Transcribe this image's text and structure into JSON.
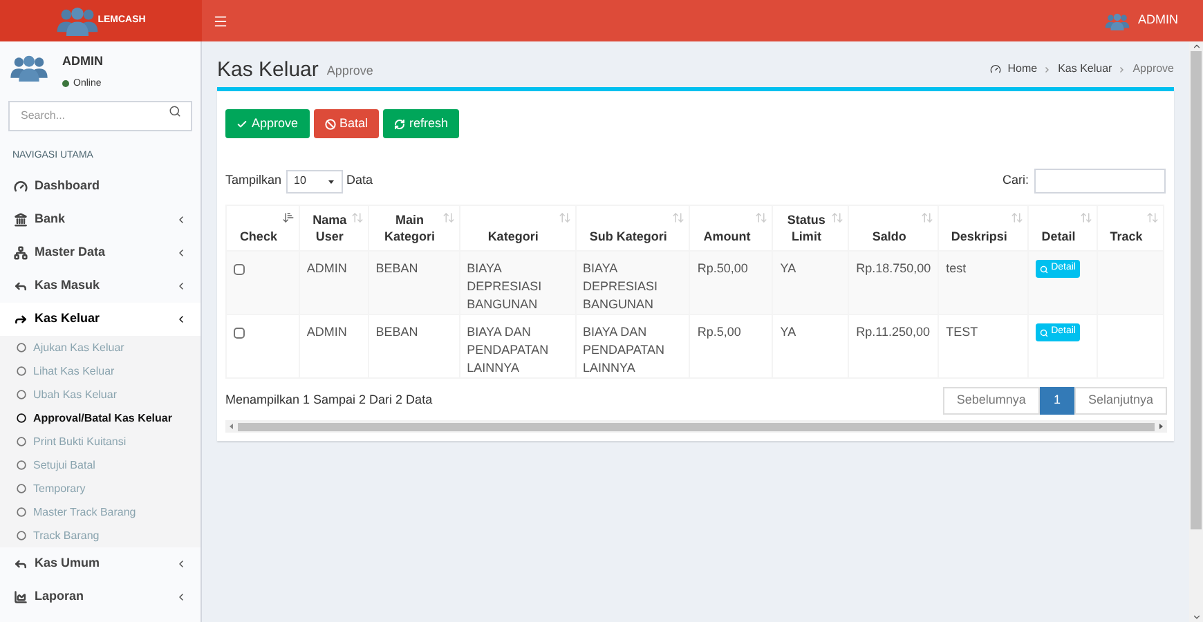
{
  "header": {
    "brand": "LEMCASH",
    "user": "ADMIN"
  },
  "sidebar": {
    "user": {
      "name": "ADMIN",
      "status": "Online"
    },
    "search": {
      "placeholder": "Search..."
    },
    "section": "NAVIGASI UTAMA",
    "items": [
      {
        "label": "Dashboard",
        "has_children": false,
        "expanded": false
      },
      {
        "label": "Bank",
        "has_children": true,
        "expanded": false
      },
      {
        "label": "Master Data",
        "has_children": true,
        "expanded": false
      },
      {
        "label": "Kas Masuk",
        "has_children": true,
        "expanded": false
      },
      {
        "label": "Kas Keluar",
        "has_children": true,
        "expanded": true,
        "children": [
          {
            "label": "Ajukan Kas Keluar",
            "selected": false
          },
          {
            "label": "Lihat Kas Keluar",
            "selected": false
          },
          {
            "label": "Ubah Kas Keluar",
            "selected": false
          },
          {
            "label": "Approval/Batal Kas Keluar",
            "selected": true
          },
          {
            "label": "Print Bukti Kuitansi",
            "selected": false
          },
          {
            "label": "Setujui Batal",
            "selected": false
          },
          {
            "label": "Temporary",
            "selected": false
          },
          {
            "label": "Master Track Barang",
            "selected": false
          },
          {
            "label": "Track Barang",
            "selected": false
          }
        ]
      },
      {
        "label": "Kas Umum",
        "has_children": true,
        "expanded": false
      },
      {
        "label": "Laporan",
        "has_children": true,
        "expanded": false
      }
    ]
  },
  "page": {
    "title": "Kas Keluar",
    "subtitle": "Approve",
    "breadcrumb": [
      "Home",
      "Kas Keluar",
      "Approve"
    ]
  },
  "actions": [
    {
      "label": "Approve",
      "kind": "approve"
    },
    {
      "label": "Batal",
      "kind": "cancel"
    },
    {
      "label": "refresh",
      "kind": "refresh"
    }
  ],
  "length": {
    "before": "Tampilkan",
    "value": "10",
    "after": "Data"
  },
  "search": {
    "label": "Cari:"
  },
  "table": {
    "columns": [
      {
        "label": "Check",
        "sorted": true
      },
      {
        "label": "Nama User",
        "sorted": false
      },
      {
        "label": "Main Kategori",
        "sorted": false
      },
      {
        "label": "Kategori",
        "sorted": false
      },
      {
        "label": "Sub Kategori",
        "sorted": false
      },
      {
        "label": "Amount",
        "sorted": false
      },
      {
        "label": "Status Limit",
        "sorted": false
      },
      {
        "label": "Saldo",
        "sorted": false
      },
      {
        "label": "Deskripsi",
        "sorted": false
      },
      {
        "label": "Detail",
        "sorted": false
      },
      {
        "label": "Track",
        "sorted": false
      }
    ],
    "rows": [
      {
        "cells": [
          {
            "kind": "checkbox",
            "checked": false
          },
          "ADMIN",
          "BEBAN",
          "BIAYA DEPRESIASI BANGUNAN",
          "BIAYA DEPRESIASI BANGUNAN",
          "Rp.50,00",
          "YA",
          "Rp.18.750,00",
          "test",
          {
            "kind": "button",
            "label": "Detail"
          }
        ]
      },
      {
        "cells": [
          {
            "kind": "checkbox",
            "checked": false
          },
          "ADMIN",
          "BEBAN",
          "BIAYA DAN PENDAPATAN LAINNYA",
          "BIAYA DAN PENDAPATAN LAINNYA",
          "Rp.5,00",
          "YA",
          "Rp.11.250,00",
          "TEST",
          {
            "kind": "button",
            "label": "Detail"
          }
        ]
      }
    ]
  },
  "info": "Menampilkan 1 Sampai 2 Dari 2 Data",
  "pagination": [
    {
      "label": "Sebelumnya",
      "selected": false
    },
    {
      "label": "1",
      "selected": true
    },
    {
      "label": "Selanjutnya",
      "selected": false
    }
  ]
}
